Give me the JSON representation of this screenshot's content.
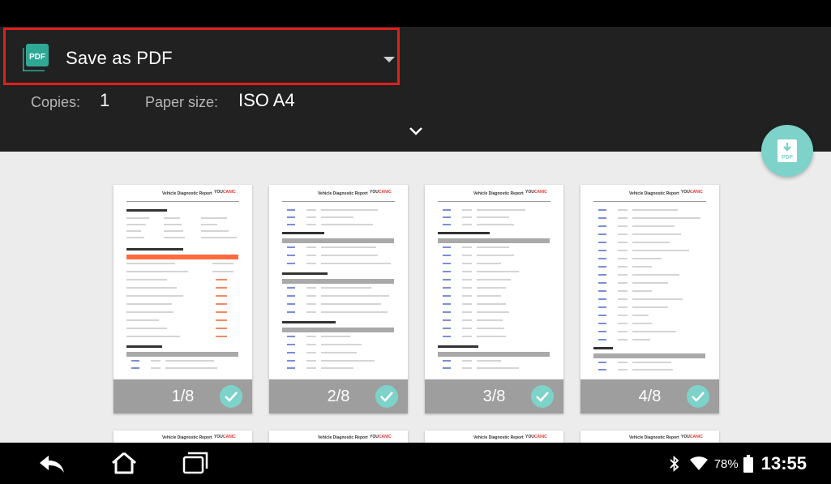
{
  "destination": {
    "label": "Save as PDF",
    "icon": "pdf-icon",
    "icon_text": "PDF"
  },
  "settings": {
    "copies_label": "Copies:",
    "copies_value": "1",
    "paper_label": "Paper size:",
    "paper_value": "ISO A4"
  },
  "fab": {
    "icon": "download-pdf-icon",
    "text": "PDF"
  },
  "document": {
    "title": "Vehicle Diagnostic Report",
    "logo_a": "YOU",
    "logo_b": "CANIC"
  },
  "pages": [
    {
      "label": "1/8",
      "selected": true
    },
    {
      "label": "2/8",
      "selected": true
    },
    {
      "label": "3/8",
      "selected": true
    },
    {
      "label": "4/8",
      "selected": true
    }
  ],
  "status": {
    "battery": "78%",
    "time": "13:55"
  },
  "colors": {
    "header_bg": "#212121",
    "accent": "#7dd2c9",
    "highlight_border": "#e0201d",
    "preview_bg": "#ececec"
  }
}
